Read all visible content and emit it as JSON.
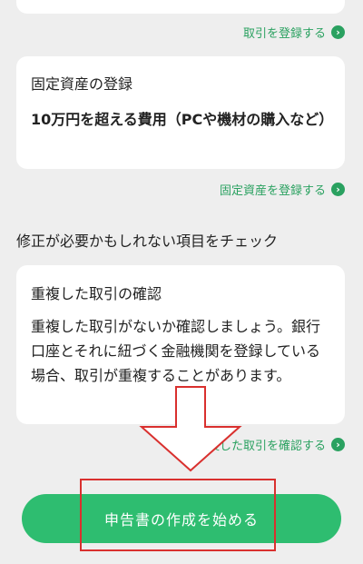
{
  "links": {
    "register_transaction": "取引を登録する",
    "register_asset": "固定資産を登録する",
    "check_duplicate": "重複した取引を確認する"
  },
  "cards": {
    "fixed_asset": {
      "title": "固定資産の登録",
      "body": "10万円を超える費用（PCや機材の購入など）"
    },
    "duplicate": {
      "title": "重複した取引の確認",
      "body": "重複した取引がないか確認しましょう。銀行口座とそれに紐づく金融機関を登録している場合、取引が重複することがあります。"
    }
  },
  "section": {
    "heading": "修正が必要かもしれない項目をチェック"
  },
  "cta": {
    "label": "申告書の作成を始める"
  },
  "icons": {
    "chevron": "chevron-right-circle-icon"
  },
  "colors": {
    "accent": "#2ebd70",
    "link": "#2aa160",
    "annotation": "#d9302e",
    "background": "#eeeeee"
  }
}
